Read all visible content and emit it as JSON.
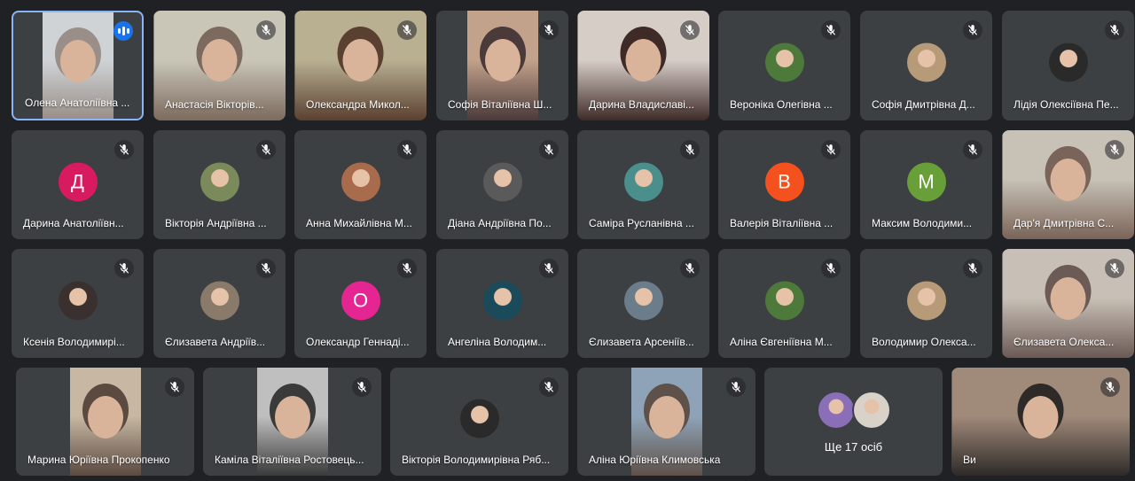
{
  "tiles": [
    {
      "name": "Олена Анатоліївна ...",
      "kind": "video",
      "speaking": true
    },
    {
      "name": "Анастасія Вікторів...",
      "kind": "video"
    },
    {
      "name": "Олександра Микол...",
      "kind": "video"
    },
    {
      "name": "Софія Віталіївна Ш...",
      "kind": "video"
    },
    {
      "name": "Дарина Владиславі...",
      "kind": "video"
    },
    {
      "name": "Вероніка Олегівна ...",
      "kind": "photo"
    },
    {
      "name": "Софія Дмитрівна Д...",
      "kind": "photo"
    },
    {
      "name": "Лідія Олексіївна Пе...",
      "kind": "photo"
    },
    {
      "name": "Дарина Анатоліївн...",
      "kind": "letter",
      "letter": "Д",
      "color": "#d81b60"
    },
    {
      "name": "Вікторія Андріївна ...",
      "kind": "photo"
    },
    {
      "name": "Анна Михайлівна М...",
      "kind": "photo"
    },
    {
      "name": "Діана Андріївна По...",
      "kind": "photo"
    },
    {
      "name": "Саміра Русланівна ...",
      "kind": "photo"
    },
    {
      "name": "Валерія Віталіївна ...",
      "kind": "letter",
      "letter": "В",
      "color": "#f4511e"
    },
    {
      "name": "Максим Володими...",
      "kind": "letter",
      "letter": "М",
      "color": "#689f38"
    },
    {
      "name": "Дар'я Дмитрівна С...",
      "kind": "video"
    },
    {
      "name": "Ксенія Володимирі...",
      "kind": "photo"
    },
    {
      "name": "Єлизавета Андріїв...",
      "kind": "photo"
    },
    {
      "name": "Олександр Геннаді...",
      "kind": "letter",
      "letter": "О",
      "color": "#e52592"
    },
    {
      "name": "Ангеліна Володим...",
      "kind": "photo"
    },
    {
      "name": "Єлизавета Арсеніїв...",
      "kind": "photo"
    },
    {
      "name": "Аліна Євгеніївна М...",
      "kind": "photo"
    },
    {
      "name": "Володимир Олекса...",
      "kind": "photo"
    },
    {
      "name": "Єлизавета Олекса...",
      "kind": "video"
    },
    {
      "name": "Марина Юріївна Прокопенко",
      "kind": "video"
    },
    {
      "name": "Каміла Віталіївна Ростовець...",
      "kind": "video"
    },
    {
      "name": "Вікторія Володимирівна Ряб...",
      "kind": "photo"
    },
    {
      "name": "Аліна Юріївна Климовська",
      "kind": "video"
    },
    {
      "name": "",
      "kind": "more",
      "label": "Ще 17 осіб"
    },
    {
      "name": "Ви",
      "kind": "video",
      "self": true
    }
  ],
  "icons": {
    "muted": "mic-off-icon",
    "speaking": "audio-level-icon"
  },
  "colors": {
    "background": "#202124",
    "tile": "#3c4043",
    "active_border": "#8ab4f8",
    "speaking": "#1a73e8"
  }
}
